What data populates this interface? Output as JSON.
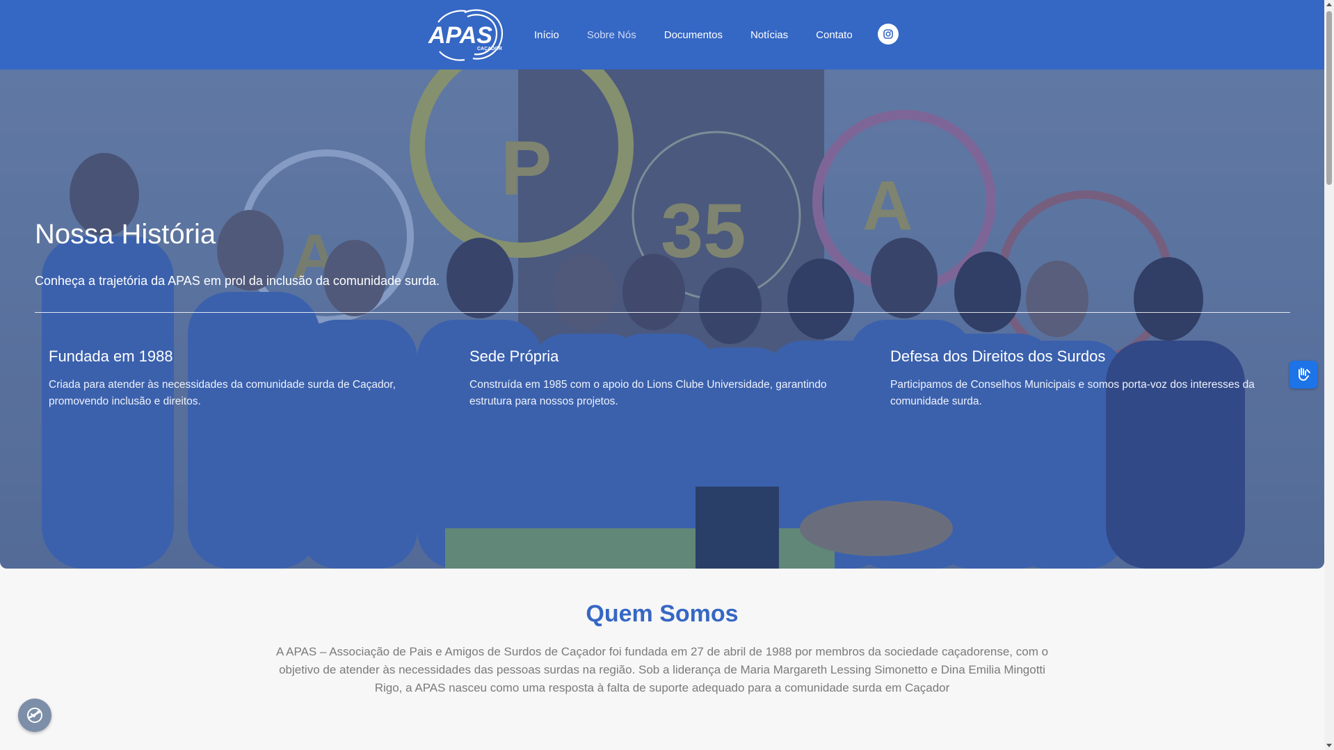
{
  "header": {
    "logo_text": "APAS",
    "logo_subtext": "CAÇADOR",
    "nav": [
      {
        "label": "Início"
      },
      {
        "label": "Sobre Nós"
      },
      {
        "label": "Documentos"
      },
      {
        "label": "Notícias"
      },
      {
        "label": "Contato"
      }
    ],
    "active_nav": "Sobre Nós",
    "instagram_icon": "instagram-icon"
  },
  "hero": {
    "title": "Nossa História",
    "subtitle": "Conheça a trajetória da APAS em prol da inclusão da comunidade surda.",
    "features": [
      {
        "title": "Fundada em 1988",
        "text": "Criada para atender às necessidades da comunidade surda de Caçador, promovendo inclusão e direitos."
      },
      {
        "title": "Sede Própria",
        "text": "Construída em 1985 com o apoio do Lions Clube Universidade, garantindo estrutura para nossos projetos."
      },
      {
        "title": "Defesa dos Direitos dos Surdos",
        "text": "Participamos de Conselhos Municipais e somos porta-voz dos interesses da comunidade surda."
      }
    ],
    "overlay_color": "#3567c4"
  },
  "about": {
    "title": "Quem Somos",
    "text": "A APAS – Associação de Pais e Amigos de Surdos de Caçador foi fundada em 27 de abril de 1988 por membros da sociedade caçadorense, com o objetivo de atender às necessidades das pessoas surdas na região. Sob a liderança de Maria Margareth Lessing Simonetto e Dina Emilia Mingotti Rigo, a APAS nasceu como uma resposta à falta de suporte adequado para a comunidade surda em Caçador"
  },
  "widgets": {
    "sign_language_icon": "hand-sign-icon",
    "accessibility_icon": "accessibility-icon"
  },
  "colors": {
    "brand": "#3567c4",
    "sign_button": "#1d73e8",
    "body_text": "#7a7a7a"
  }
}
